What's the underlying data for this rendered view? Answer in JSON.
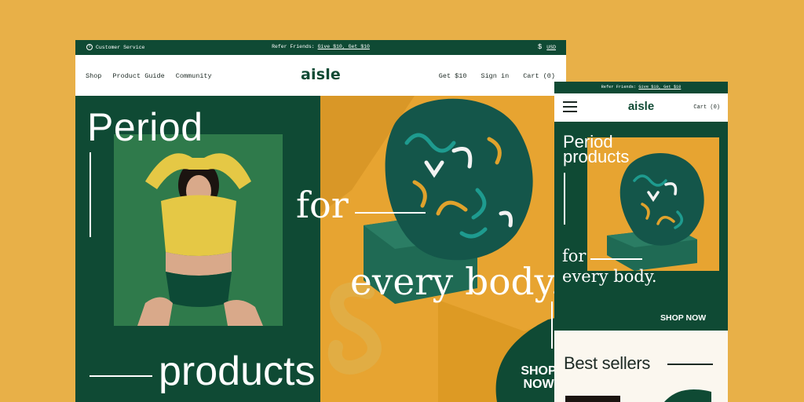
{
  "background_color": "#e8b048",
  "brand_color": "#0f4a34",
  "accent_color": "#e7a431",
  "desktop": {
    "topbar": {
      "help_icon": "question-circle-icon",
      "customer_service": "Customer Service",
      "refer_prefix": "Refer Friends:",
      "refer_link": "Give $10, Get $10",
      "currency_symbol": "$",
      "currency": "USD"
    },
    "nav": {
      "links": [
        "Shop",
        "Product Guide",
        "Community"
      ],
      "logo": "aisle",
      "get10": "Get $10",
      "signin": "Sign in",
      "cart": "Cart (0)"
    },
    "hero": {
      "word1": "Period",
      "word2": "for",
      "word3": "every body.",
      "word4": "products",
      "cta_line1": "SHOP",
      "cta_line2": "NOW"
    }
  },
  "mobile": {
    "topbar": {
      "refer_prefix": "Refer Friends:",
      "refer_link": "Give $10, Get $10"
    },
    "nav": {
      "menu_icon": "hamburger-menu-icon",
      "logo": "aisle",
      "cart": "Cart (0)"
    },
    "hero": {
      "line1": "Period",
      "line2": "products",
      "line3": "for",
      "line4": "every body.",
      "cta": "SHOP NOW"
    },
    "best_sellers": "Best sellers"
  }
}
